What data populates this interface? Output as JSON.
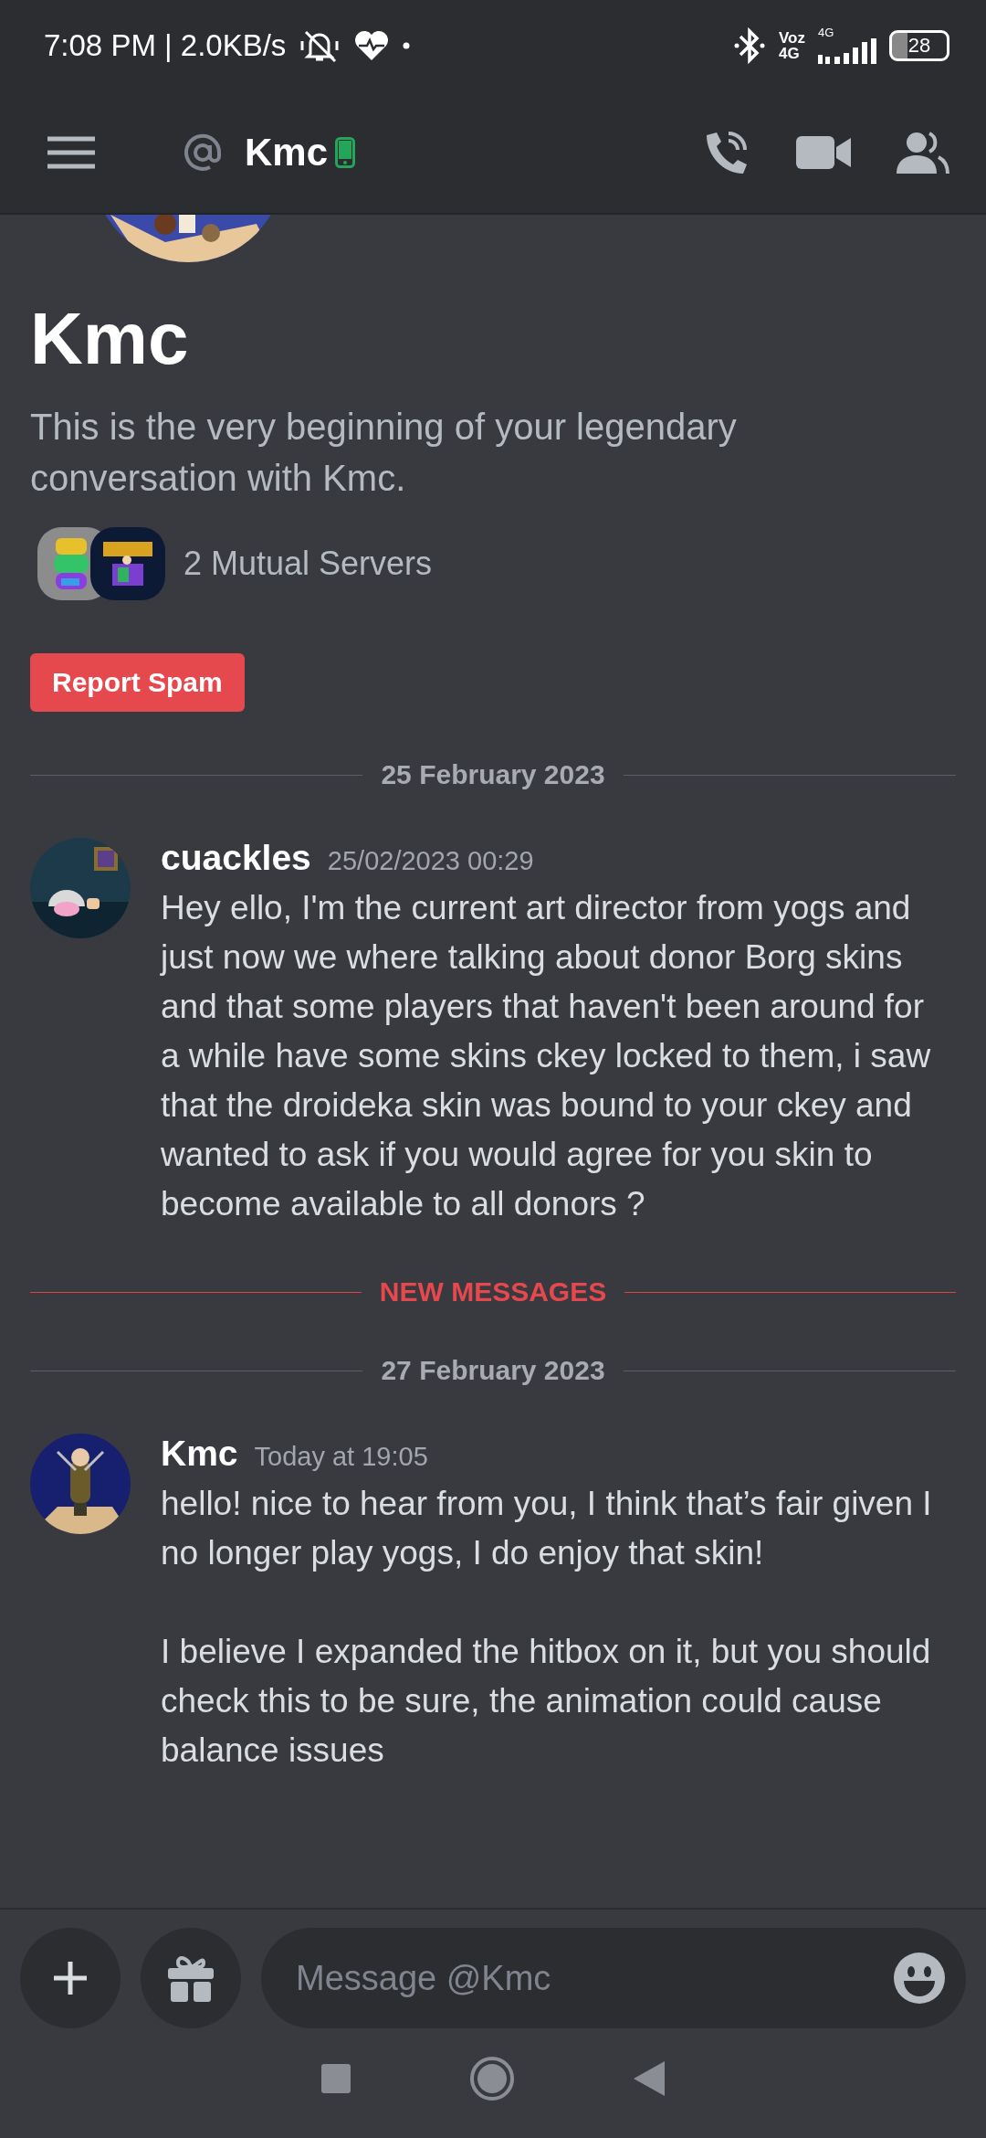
{
  "status_bar": {
    "time": "7:08 PM | 2.0KB/s",
    "volte_top": "Voz",
    "volte_bottom": "4G",
    "signal_label": "4G",
    "battery": "28"
  },
  "header": {
    "title": "Kmc"
  },
  "intro": {
    "title": "Kmc",
    "description": "This is the very beginning of your legendary conversation with Kmc.",
    "mutual_servers": "2 Mutual Servers",
    "report_button": "Report Spam"
  },
  "timeline": [
    {
      "kind": "date_divider",
      "label": "25 February 2023"
    },
    {
      "kind": "message",
      "author": "cuackles",
      "timestamp": "25/02/2023 00:29",
      "paragraphs": [
        "Hey ello, I'm the current art director from yogs and just now we where talking about donor Borg skins and that some players that haven't been around for a while have some skins ckey locked to them, i saw that the droideka skin was bound to your ckey and wanted to ask if you would agree for you skin to become available to all donors ?"
      ]
    },
    {
      "kind": "new_divider",
      "label": "NEW MESSAGES"
    },
    {
      "kind": "date_divider",
      "label": "27 February 2023"
    },
    {
      "kind": "message",
      "author": "Kmc",
      "timestamp": "Today at 19:05",
      "paragraphs": [
        "hello! nice to hear from you, I think that’s fair given I no longer play yogs, I do enjoy that skin!",
        "I believe I expanded the hitbox on it, but you should check this to be sure, the animation could cause balance issues"
      ]
    }
  ],
  "composer": {
    "placeholder": "Message @Kmc"
  }
}
